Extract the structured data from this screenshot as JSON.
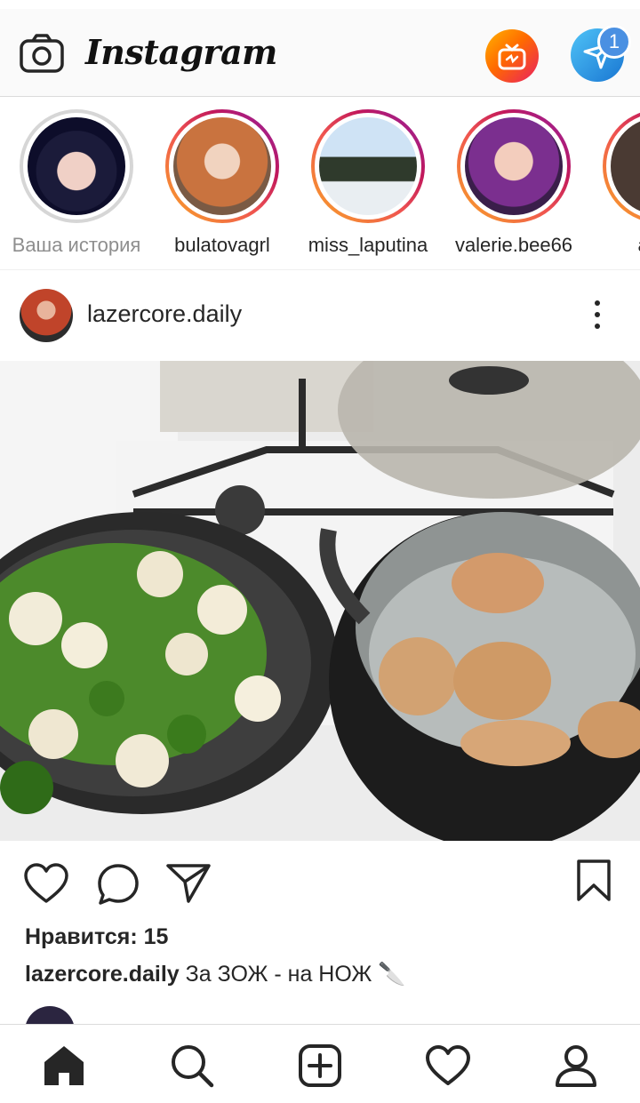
{
  "app": {
    "title": "Instagram"
  },
  "header": {
    "logo": "Instagram",
    "dm_badge_count": "1"
  },
  "stories": [
    {
      "name": "Ваша история",
      "own": true
    },
    {
      "name": "bulatovagrl",
      "own": false
    },
    {
      "name": "miss_laputina",
      "own": false
    },
    {
      "name": "valerie.bee66",
      "own": false
    },
    {
      "name": "annu",
      "own": false
    }
  ],
  "post": {
    "username": "lazercore.daily",
    "likes": "Нравится: 15",
    "caption_user": "lazercore.daily",
    "caption_text": "За ЗОЖ - на НОЖ 🔪"
  },
  "colors": {
    "story_ring_start": "#f9a825",
    "story_ring_end": "#8e24aa",
    "igtv": "#ff6a00",
    "dm": "#1976d2",
    "badge": "#4a90e2"
  },
  "icons": {
    "camera": "camera-icon",
    "igtv": "igtv-icon",
    "direct": "direct-icon",
    "more": "more-icon",
    "like": "heart-icon",
    "comment": "comment-icon",
    "share": "send-icon",
    "save": "bookmark-icon",
    "home": "home-icon",
    "search": "search-icon",
    "add": "add-icon",
    "activity": "heart-icon",
    "profile": "profile-icon"
  }
}
